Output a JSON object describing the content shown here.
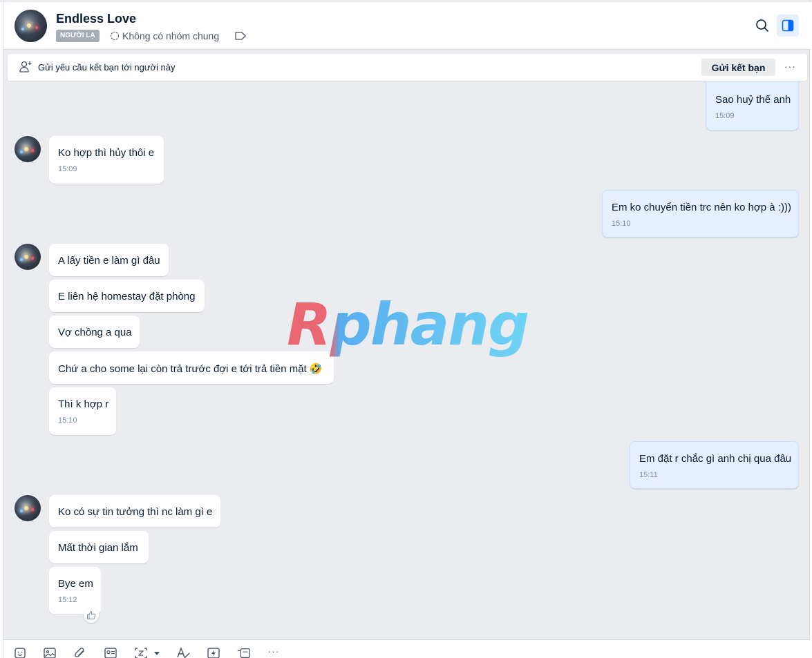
{
  "header": {
    "contact_name": "Endless Love",
    "badge": "NGƯỜI LẠ",
    "group_info": "Không có nhóm chung"
  },
  "friend_bar": {
    "text": "Gửi yêu cầu kết bạn tới người này",
    "button_label": "Gửi kết bạn",
    "more_label": "···"
  },
  "messages": [
    {
      "sender": "me",
      "text": "Sao huỷ thế anh",
      "time": "15:09"
    },
    {
      "sender": "them",
      "text": "Ko hợp thì hủy thôi e",
      "time": "15:09"
    },
    {
      "sender": "me",
      "text": "Em ko chuyển tiền trc nên ko hợp à :)))",
      "time": "15:10"
    },
    {
      "sender": "them",
      "text": "A lấy tiền e làm gì đâu"
    },
    {
      "sender": "them",
      "text": "E liên hệ homestay đặt phòng"
    },
    {
      "sender": "them",
      "text": "Vợ chồng a qua"
    },
    {
      "sender": "them",
      "text": "Chứ a cho some lại còn trả trước đợi e tới trả tiền mặt 🤣"
    },
    {
      "sender": "them",
      "text": "Thì k hợp r",
      "time": "15:10"
    },
    {
      "sender": "me",
      "text": "Em đặt r chắc gì anh chị qua đâu",
      "time": "15:11"
    },
    {
      "sender": "them",
      "text": "Ko có sự tin tưởng thì nc làm gì e"
    },
    {
      "sender": "them",
      "text": "Mất thời gian lắm"
    },
    {
      "sender": "them",
      "text": "Bye em",
      "time": "15:12"
    }
  ],
  "watermark": "Rphang",
  "toolbar": {
    "icons": [
      "sticker-icon",
      "image-icon",
      "attachment-icon",
      "contact-card-icon",
      "screenshot-icon",
      "dropdown-icon",
      "text-format-icon",
      "quick-message-icon",
      "task-icon",
      "more-icon"
    ],
    "more_label": "···"
  },
  "colors": {
    "my_bubble": "#e5efff",
    "their_bubble": "#ffffff",
    "chat_background": "#ebecf0",
    "accent": "#0068ff"
  }
}
